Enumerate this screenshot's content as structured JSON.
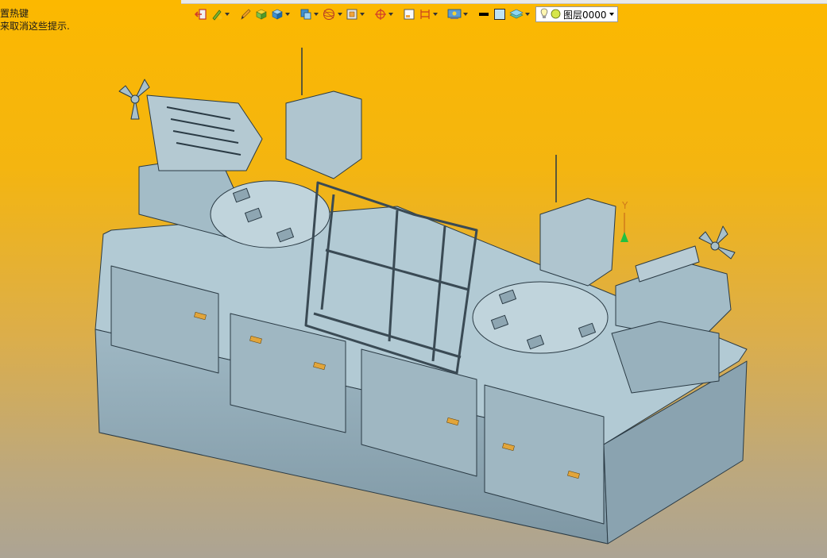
{
  "window": {
    "hint_lines": [
      "置热键",
      "来取消这些提示."
    ]
  },
  "toolbar": {
    "layer_combo": {
      "value": "图层0000"
    },
    "icons": [
      "exit-icon",
      "pen-icon",
      "pencil-icon",
      "box-icon",
      "solid-icon",
      "view-icon",
      "sphere-icon",
      "frame-icon",
      "snap-icon",
      "page-icon",
      "dimension-icon",
      "render-icon",
      "line-color-icon",
      "fill-color-icon",
      "material-icon",
      "lightbulb-icon",
      "layer-icon"
    ]
  },
  "viewport": {
    "axis_label": "Y",
    "background_top": "#fcb800",
    "background_bottom": "#aca494",
    "model_color": "#a8c2cc"
  }
}
